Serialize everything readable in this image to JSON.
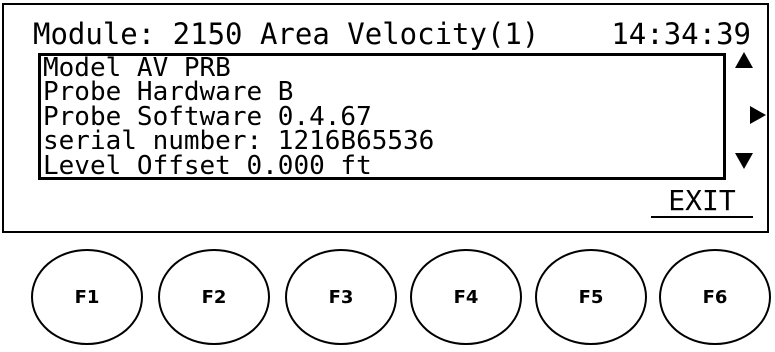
{
  "screen": {
    "header": {
      "module": "Module: 2150 Area Velocity(1)",
      "time": "14:34:39"
    },
    "info_lines": [
      "Model AV PRB",
      "Probe Hardware B",
      "Probe Software 0.4.67",
      "serial number: 1216B65536",
      "Level Offset 0.000 ft"
    ],
    "exit_label": "EXIT",
    "icons": {
      "scroll_up": "triangle-up-icon",
      "scroll_right": "triangle-right-icon",
      "scroll_down": "triangle-down-icon"
    }
  },
  "function_keys": [
    {
      "label": "F1"
    },
    {
      "label": "F2"
    },
    {
      "label": "F3"
    },
    {
      "label": "F4"
    },
    {
      "label": "F5"
    },
    {
      "label": "F6"
    }
  ]
}
